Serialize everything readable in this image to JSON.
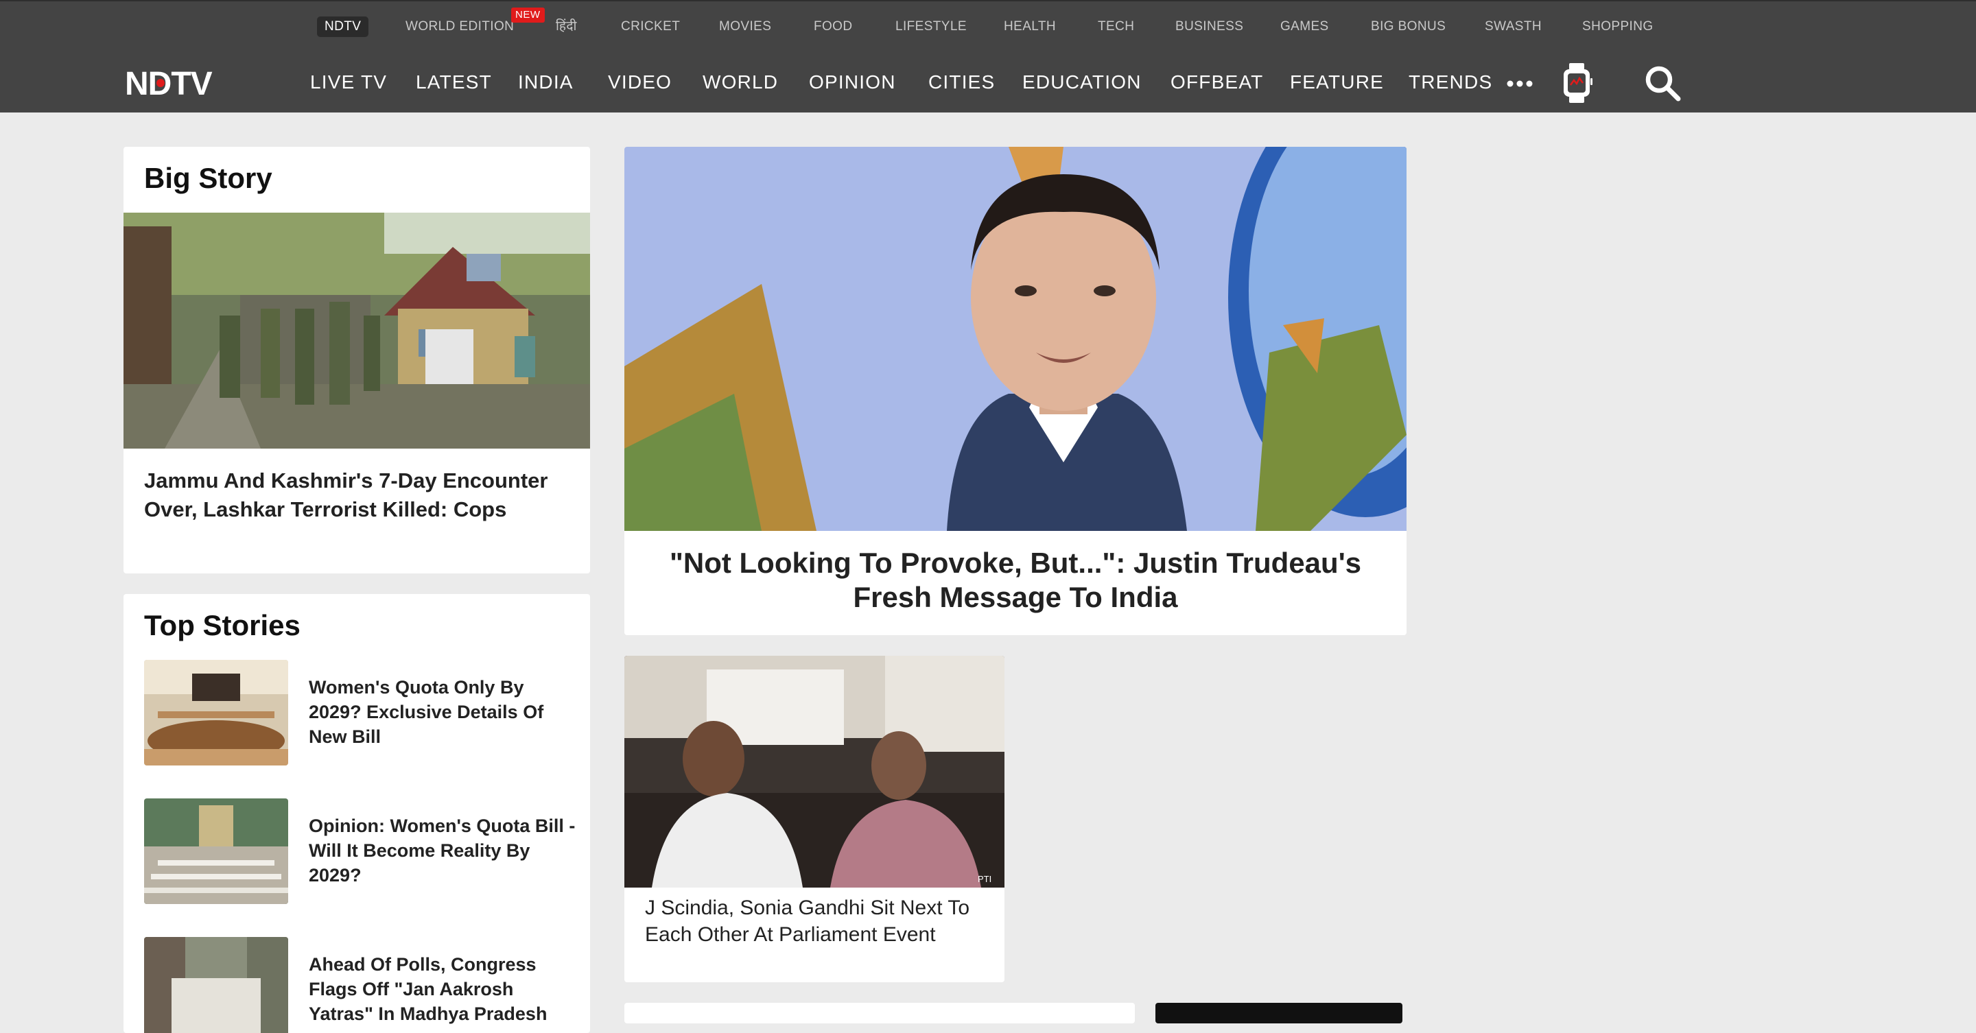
{
  "top_nav": {
    "items": [
      "NDTV",
      "WORLD EDITION",
      "हिंदी",
      "CRICKET",
      "MOVIES",
      "FOOD",
      "LIFESTYLE",
      "HEALTH",
      "TECH",
      "BUSINESS",
      "GAMES",
      "BIG BONUS",
      "SWASTH",
      "SHOPPING"
    ],
    "new_badge": "NEW"
  },
  "logo": {
    "text": "NDTV"
  },
  "main_nav": {
    "items": [
      "LIVE TV",
      "LATEST",
      "INDIA",
      "VIDEO",
      "WORLD",
      "OPINION",
      "CITIES",
      "EDUCATION",
      "OFFBEAT",
      "FEATURE",
      "TRENDS"
    ],
    "more_icon": "more-dots-icon",
    "watch_icon": "smartwatch-icon",
    "search_icon": "search-icon"
  },
  "big_story": {
    "title": "Big Story",
    "headline": "Jammu And Kashmir's 7-Day Encounter Over, Lashkar Terrorist Killed: Cops"
  },
  "lead_story": {
    "headline": "\"Not Looking To Provoke, But...\": Justin Trudeau's Fresh Message To India"
  },
  "secondary_story": {
    "headline": "J Scindia, Sonia Gandhi Sit Next To Each Other At Parliament Event",
    "photo_credit": "PTI"
  },
  "top_stories": {
    "title": "Top Stories",
    "items": [
      {
        "headline": "Women's Quota Only By 2029? Exclusive Details Of New Bill"
      },
      {
        "headline": "Opinion: Women's Quota Bill - Will It Become Reality By 2029?"
      },
      {
        "headline": "Ahead Of Polls, Congress Flags Off \"Jan Aakrosh Yatras\" In Madhya Pradesh"
      }
    ]
  },
  "colors": {
    "header_bg": "#444444",
    "page_bg": "#ebebeb",
    "logo_dot": "#e01b1b",
    "new_badge": "#e01b1b"
  }
}
